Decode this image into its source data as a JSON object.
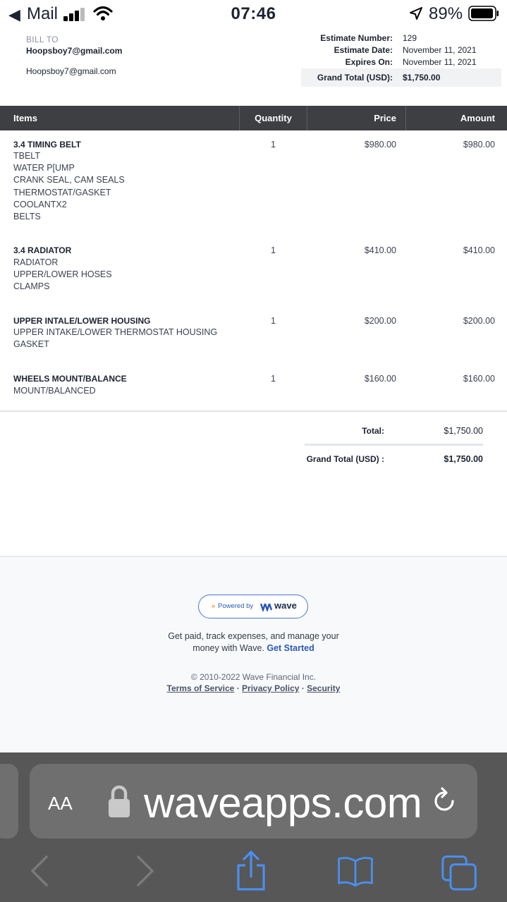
{
  "status_bar": {
    "back_label": "Mail",
    "time": "07:46",
    "battery": "89%"
  },
  "bill_to": {
    "label": "BILL TO",
    "name": "Hoopsboy7@gmail.com",
    "email": "Hoopsboy7@gmail.com"
  },
  "estimate": {
    "number_label": "Estimate Number:",
    "number": "129",
    "date_label": "Estimate Date:",
    "date": "November 11, 2021",
    "expires_label": "Expires On:",
    "expires": "November 11, 2021",
    "grand_total_label": "Grand Total (USD):",
    "grand_total": "$1,750.00"
  },
  "table": {
    "headers": [
      "Items",
      "Quantity",
      "Price",
      "Amount"
    ],
    "rows": [
      {
        "title": "3.4 TIMING BELT",
        "desc": "TBELT\nWATER P[UMP\nCRANK SEAL, CAM SEALS\nTHERMOSTAT/GASKET\nCOOLANTX2\nBELTS",
        "qty": "1",
        "price": "$980.00",
        "amount": "$980.00"
      },
      {
        "title": "3.4 RADIATOR",
        "desc": "RADIATOR\nUPPER/LOWER HOSES\nCLAMPS",
        "qty": "1",
        "price": "$410.00",
        "amount": "$410.00"
      },
      {
        "title": "UPPER INTALE/LOWER HOUSING",
        "desc": "UPPER INTAKE/LOWER THERMOSTAT HOUSING\nGASKET",
        "qty": "1",
        "price": "$200.00",
        "amount": "$200.00"
      },
      {
        "title": "WHEELS MOUNT/BALANCE",
        "desc": "MOUNT/BALANCED",
        "qty": "1",
        "price": "$160.00",
        "amount": "$160.00"
      }
    ]
  },
  "totals": {
    "total_label": "Total:",
    "total": "$1,750.00",
    "grand_label": "Grand Total (USD) :",
    "grand": "$1,750.00"
  },
  "footer": {
    "powered_by": "Powered by",
    "brand": "wave",
    "line1": "Get paid, track expenses, and manage your",
    "line2": "money with Wave.",
    "get_started": "Get Started",
    "copyright": "© 2010-2022 Wave Financial Inc.",
    "terms": "Terms of Service",
    "privacy": "Privacy Policy",
    "security": "Security",
    "sep": "·"
  },
  "browser": {
    "text_size_label": "AA",
    "url": "waveapps.com"
  },
  "colors": {
    "table_header": "#3d3f42",
    "link_blue": "#2b58b8",
    "ios_blue": "#4a8ff0",
    "chrome_bg": "#575757"
  }
}
